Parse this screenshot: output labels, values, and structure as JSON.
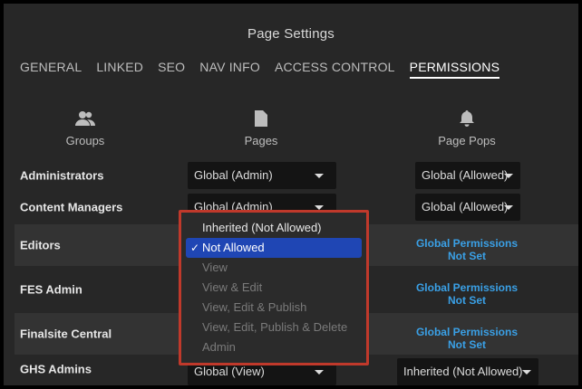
{
  "title": "Page Settings",
  "tabs": [
    "GENERAL",
    "LINKED",
    "SEO",
    "NAV INFO",
    "ACCESS CONTROL",
    "PERMISSIONS"
  ],
  "active_tab": "PERMISSIONS",
  "columns": {
    "groups": {
      "label": "Groups",
      "icon": "users-icon"
    },
    "pages": {
      "label": "Pages",
      "icon": "page-icon"
    },
    "page_pops": {
      "label": "Page Pops",
      "icon": "bell-icon"
    }
  },
  "rows": [
    {
      "label": "Administrators",
      "pages": "Global (Admin)",
      "pops": "Global (Allowed)"
    },
    {
      "label": "Content Managers",
      "pages": "Global (Admin)",
      "pops": "Global (Allowed)"
    },
    {
      "label": "Editors",
      "gp_line1": "Global Permissions",
      "gp_line2": "Not Set"
    },
    {
      "label": "FES Admin",
      "gp_line1": "Global Permissions",
      "gp_line2": "Not Set"
    },
    {
      "label": "Finalsite Central",
      "gp_line1": "Global Permissions",
      "gp_line2": "Not Set"
    },
    {
      "label": "GHS Admins",
      "pages": "Global (View)",
      "pops": "Inherited (Not Allowed)"
    }
  ],
  "dropdown": {
    "check": "✓",
    "options": [
      {
        "label": "Inherited (Not Allowed)",
        "enabled": true,
        "selected": false
      },
      {
        "label": "Not Allowed",
        "enabled": true,
        "selected": true
      },
      {
        "label": "View",
        "enabled": false,
        "selected": false
      },
      {
        "label": "View & Edit",
        "enabled": false,
        "selected": false
      },
      {
        "label": "View, Edit & Publish",
        "enabled": false,
        "selected": false
      },
      {
        "label": "View, Edit, Publish & Delete",
        "enabled": false,
        "selected": false
      },
      {
        "label": "Admin",
        "enabled": false,
        "selected": false
      }
    ]
  },
  "colors": {
    "accent_link": "#3aa0e6",
    "selected_option": "#1f46b4",
    "highlight_border": "#c0392b"
  }
}
